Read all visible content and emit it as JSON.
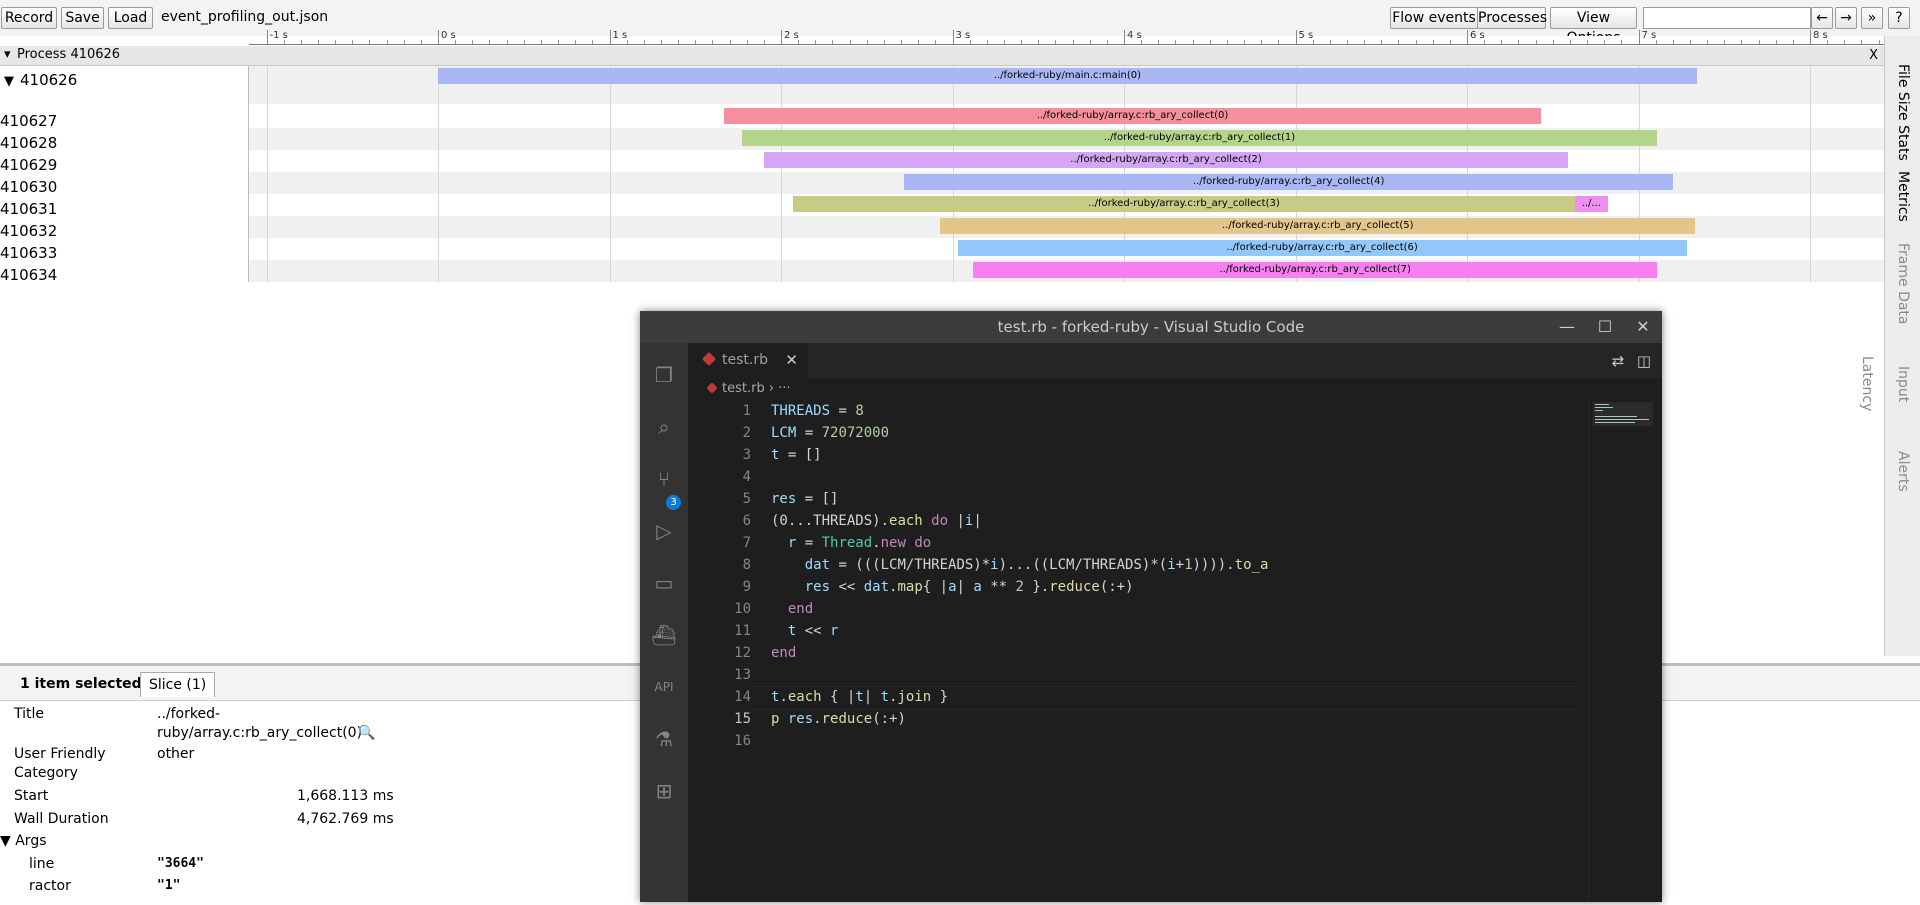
{
  "toolbar": {
    "record_label": "Record",
    "save_label": "Save",
    "load_label": "Load",
    "filename": "event_profiling_out.json",
    "flow_events_label": "Flow events",
    "processes_label": "Processes",
    "view_options_label": "View Options",
    "search_value": "",
    "prev_label": "←",
    "next_label": "→",
    "more_label": "»",
    "help_label": "?"
  },
  "ruler": {
    "ticks": [
      "-1 s",
      "0 s",
      "1 s",
      "2 s",
      "3 s",
      "4 s",
      "5 s",
      "6 s",
      "7 s",
      "8 s"
    ]
  },
  "process": {
    "header": "Process 410626",
    "close_label": "X",
    "main_thread": "410626",
    "threads": [
      "410627",
      "410628",
      "410629",
      "410630",
      "410631",
      "410632",
      "410633",
      "410634"
    ]
  },
  "slices": {
    "main": {
      "label": "../forked-ruby/main.c:main(0)",
      "color": "#a9b8f5",
      "start_s": 0.0,
      "end_s": 7.34
    },
    "threads": [
      {
        "label": "../forked-ruby/array.c:rb_ary_collect(0)",
        "color": "#f58f9e",
        "start_s": 1.67,
        "end_s": 6.43
      },
      {
        "label": "../forked-ruby/array.c:rb_ary_collect(1)",
        "color": "#b4d48a",
        "start_s": 1.77,
        "end_s": 7.11
      },
      {
        "label": "../forked-ruby/array.c:rb_ary_collect(2)",
        "color": "#d6a6f6",
        "start_s": 1.9,
        "end_s": 6.59
      },
      {
        "label": "../forked-ruby/array.c:rb_ary_collect(4)",
        "color": "#a9b8f5",
        "start_s": 2.72,
        "end_s": 7.2
      },
      {
        "label": "../forked-ruby/array.c:rb_ary_collect(3)",
        "color": "#c8cb84",
        "start_s": 2.07,
        "end_s": 6.63
      },
      {
        "label": "../forked-ruby/array.c:rb_ary_collect(5)",
        "color": "#e3c68a",
        "start_s": 2.93,
        "end_s": 7.33
      },
      {
        "label": "../forked-ruby/array.c:rb_ary_collect(6)",
        "color": "#92c7f9",
        "start_s": 3.03,
        "end_s": 7.28
      },
      {
        "label": "../forked-ruby/array.c:rb_ary_collect(7)",
        "color": "#f77ff0",
        "start_s": 3.12,
        "end_s": 7.11
      }
    ],
    "extra": {
      "label": "../...",
      "color": "#ef8ff0",
      "start_s": 6.63,
      "end_s": 6.82
    }
  },
  "side_tabs": [
    "File Size Stats",
    "Metrics",
    "Frame Data",
    "Input Latency",
    "Alerts"
  ],
  "details": {
    "selection_count": "1 item selected.",
    "tab_label": "Slice (1)",
    "title_key": "Title",
    "title_value_line1": "../forked-",
    "title_value_line2": "ruby/array.c:rb_ary_collect(0)",
    "category_key_line1": "User Friendly",
    "category_key_line2": "Category",
    "category_value": "other",
    "start_key": "Start",
    "start_value": "1,668.113 ms",
    "wall_key": "Wall Duration",
    "wall_value": "4,762.769 ms",
    "args_key": "Args",
    "line_key": "line",
    "line_value": "\"3664\"",
    "ractor_key": "ractor",
    "ractor_value": "\"1\""
  },
  "vscode": {
    "title": "test.rb - forked-ruby - Visual Studio Code",
    "tab_name": "test.rb",
    "breadcrumb_file": "test.rb",
    "breadcrumb_more": "› ···",
    "scm_badge": "3"
  }
}
